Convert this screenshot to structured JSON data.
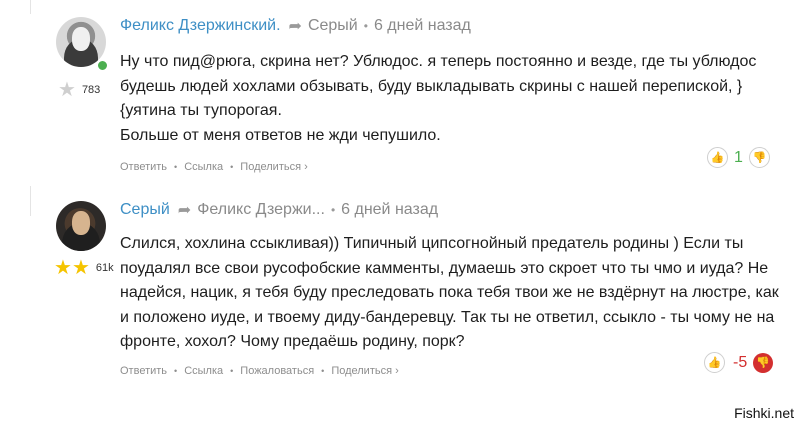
{
  "comments": [
    {
      "author": "Феликс Дзержинский.",
      "reply_to": "Серый",
      "time": "6 дней назад",
      "rating": "783",
      "text_lines": [
        "Ну что пид@рюга, скрина нет? Ублюдос. я теперь постоянно и везде, где ты ублюдос",
        "будешь людей хохлами обзывать, буду выкладывать скрины с нашей перепиской, }",
        "{уятина ты тупорогая.",
        "Больше от меня ответов не жди чепушило."
      ],
      "actions": [
        "Ответить",
        "Ссылка",
        "Поделиться ›"
      ],
      "score": "1"
    },
    {
      "author": "Серый",
      "reply_to": "Феликс Дзержи...",
      "time": "6 дней назад",
      "rating": "61k",
      "text_lines": [
        "Слился, хохлина ссыкливая)) Типичный ципсогнойный предатель родины ) Если ты",
        "поудалял все свои русофобские камменты, думаешь это скроет что ты чмо и иуда? Не",
        "надейся, нацик, я тебя буду преследовать пока тебя твои же не вздёрнут на люстре, как",
        "и положено иуде, и твоему диду-бандеревцу. Так ты не ответил, ссыкло - ты чому не на",
        "фронте, хохол? Чому предаёшь родину, порк?"
      ],
      "actions": [
        "Ответить",
        "Ссылка",
        "Пожаловаться",
        "Поделиться ›"
      ],
      "score": "-5"
    }
  ],
  "watermark": "Fishki.net",
  "colors": {
    "author": "#3e8fc5",
    "positive": "#4caf50",
    "negative": "#d32f2f"
  }
}
